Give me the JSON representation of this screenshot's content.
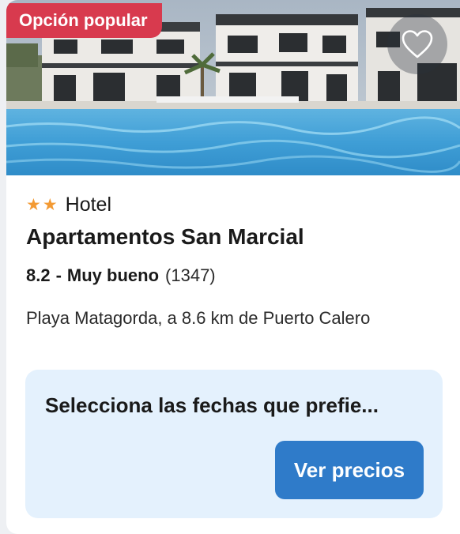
{
  "listing": {
    "badge": "Opción popular",
    "favorite_icon": "heart-outline-icon",
    "star_icon": "star-icon",
    "star_color": "#f39a33",
    "star_rating": 2,
    "type": "Hotel",
    "name": "Apartamentos San Marcial",
    "rating": {
      "score": "8.2",
      "separator": "-",
      "label": "Muy bueno",
      "count": "(1347)"
    },
    "location": "Playa Matagorda, a 8.6 km de Puerto Calero"
  },
  "pricing": {
    "prompt": "Selecciona las fechas que prefie...",
    "button_label": "Ver precios"
  },
  "colors": {
    "badge_bg": "#d83a4e",
    "button_bg": "#2f7bc9",
    "price_box_bg": "#e4f1fd"
  }
}
